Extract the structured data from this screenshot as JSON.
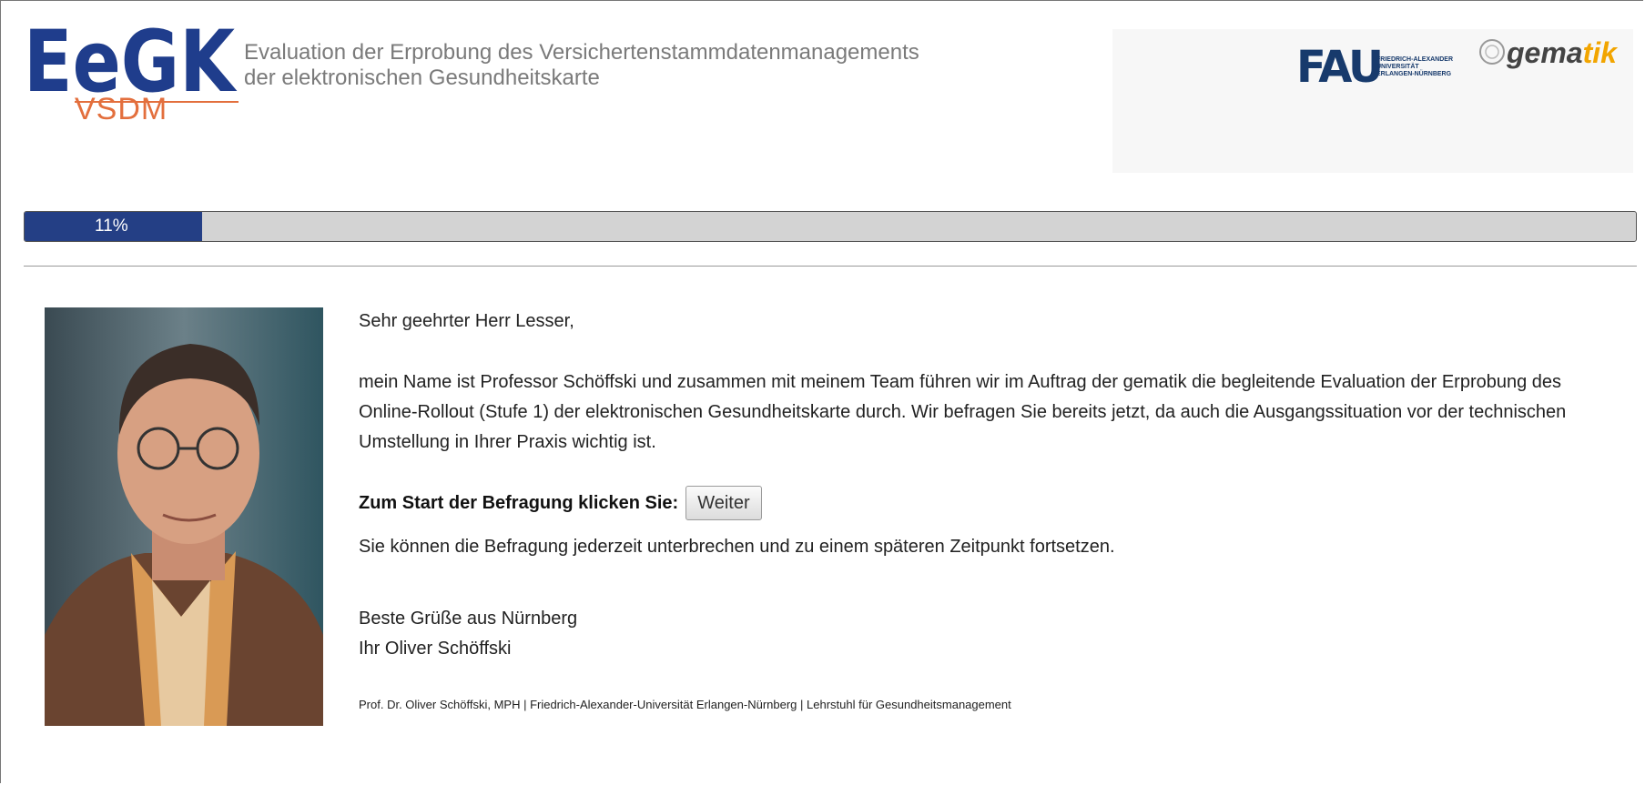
{
  "header": {
    "logo_text": "EeGK",
    "logo_sub": "VSDM",
    "title_line1": "Evaluation der Erprobung des Versichertenstammdatenmanagements",
    "title_line2": "der elektronischen Gesundheitskarte",
    "partner_fau": "FAU",
    "partner_fau_sub": "FRIEDRICH-ALEXANDER UNIVERSITÄT ERLANGEN-NÜRNBERG",
    "partner_gematik_a": "gema",
    "partner_gematik_b": "tik"
  },
  "progress": {
    "percent": 11,
    "label": "11%"
  },
  "letter": {
    "salutation": "Sehr geehrter Herr Lesser,",
    "body": "mein Name ist Professor Schöffski und zusammen mit meinem Team führen wir im Auftrag der gematik die begleitende Evaluation der Erprobung des Online-Rollout (Stufe 1) der elektronischen Gesundheitskarte durch. Wir befragen Sie bereits jetzt, da auch die Ausgangssituation vor der technischen Umstellung in Ihrer Praxis wichtig ist.",
    "start_label": "Zum Start der Befragung klicken Sie:",
    "continue_button": "Weiter",
    "note": "Sie können die Befragung jederzeit unterbrechen und zu einem späteren Zeitpunkt fortsetzen.",
    "closing": "Beste Grüße aus Nürnberg",
    "signature": "Ihr Oliver Schöffski",
    "footer": "Prof. Dr. Oliver Schöffski, MPH | Friedrich-Alexander-Universität Erlangen-Nürnberg | Lehrstuhl für Gesundheitsmanagement"
  },
  "colors": {
    "accent": "#243f85",
    "logo_blue": "#1f3d8c",
    "logo_orange": "#e36f3d",
    "progress_track": "#d3d3d3"
  }
}
